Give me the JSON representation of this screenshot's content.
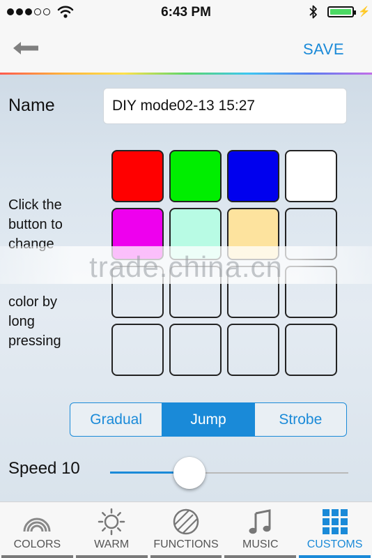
{
  "status_bar": {
    "time": "6:43 PM",
    "signal_strength": 3,
    "signal_max": 5
  },
  "nav": {
    "save_label": "SAVE"
  },
  "form": {
    "name_label": "Name",
    "name_value": "DIY mode02-13 15:27",
    "instruction_top": [
      "Click the",
      "button to",
      "change"
    ],
    "instruction_bottom": [
      "color by",
      "long",
      "pressing"
    ]
  },
  "swatches": [
    "#ff0000",
    "#00ee00",
    "#0000ee",
    "#ffffff",
    "#ee00ee",
    "#b8fbe4",
    "#fde39e",
    "",
    "",
    "",
    "",
    "",
    "",
    "",
    "",
    ""
  ],
  "watermark": "trade.china.cn",
  "modes": {
    "options": [
      "Gradual",
      "Jump",
      "Strobe"
    ],
    "selected": "Jump"
  },
  "speed": {
    "label": "Speed 10",
    "value": 10,
    "max": 30
  },
  "tabs": [
    {
      "label": "COLORS",
      "icon": "rainbow-icon"
    },
    {
      "label": "WARM",
      "icon": "sun-icon"
    },
    {
      "label": "FUNCTIONS",
      "icon": "striped-circle-icon"
    },
    {
      "label": "MUSIC",
      "icon": "music-note-icon"
    },
    {
      "label": "CUSTOMS",
      "icon": "grid-icon"
    }
  ],
  "active_tab": "CUSTOMS",
  "colors": {
    "accent": "#1a8ad8",
    "battery": "#4cd964"
  }
}
